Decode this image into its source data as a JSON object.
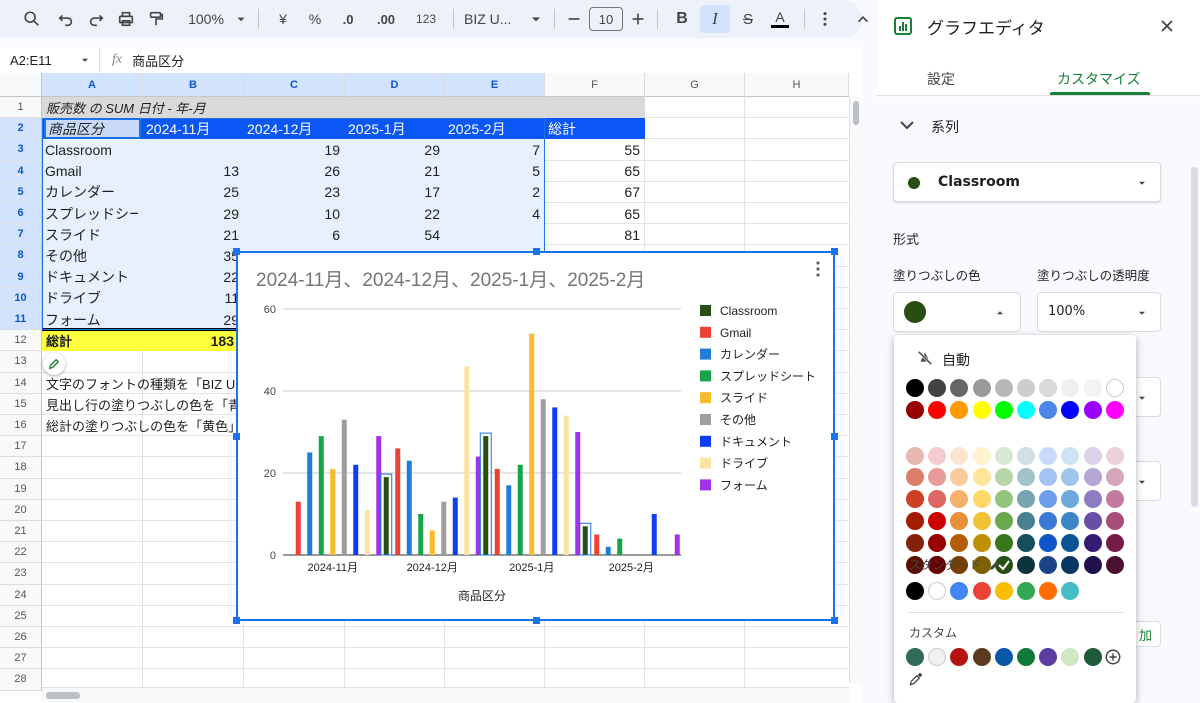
{
  "toolbar": {
    "zoom": "100%",
    "currency": "¥",
    "percent": "%",
    "dec_less": ".0",
    "dec_more": ".00",
    "number_format": "123",
    "font": "BIZ U...",
    "font_size": "10"
  },
  "formula_bar": {
    "name_box": "A2:E11",
    "fx": "fx",
    "content": "商品区分"
  },
  "sheet": {
    "columns": [
      "A",
      "B",
      "C",
      "D",
      "E",
      "F",
      "G",
      "H"
    ],
    "rows": [
      "1",
      "2",
      "3",
      "4",
      "5",
      "6",
      "7",
      "8",
      "9",
      "10",
      "11",
      "12",
      "13",
      "14",
      "15",
      "16",
      "17",
      "18",
      "19",
      "20",
      "21",
      "22",
      "23",
      "24",
      "25",
      "26",
      "27",
      "28"
    ],
    "pivot_title": "販売数 の SUM 日付 - 年-月",
    "header": [
      "商品区分",
      "2024-11月",
      "2024-12月",
      "2025-1月",
      "2025-2月",
      "総計"
    ],
    "data": [
      [
        "Classroom",
        "",
        "19",
        "29",
        "7",
        "55"
      ],
      [
        "Gmail",
        "13",
        "26",
        "21",
        "5",
        "65"
      ],
      [
        "カレンダー",
        "25",
        "23",
        "17",
        "2",
        "67"
      ],
      [
        "スプレッドシート",
        "29",
        "10",
        "22",
        "4",
        "65"
      ],
      [
        "スライド",
        "21",
        "6",
        "54",
        "",
        "81"
      ],
      [
        "その他",
        "35",
        "",
        "",
        "",
        ""
      ],
      [
        "ドキュメント",
        "22",
        "",
        "",
        "",
        ""
      ],
      [
        "ドライブ",
        "11",
        "",
        "",
        "",
        ""
      ],
      [
        "フォーム",
        "29",
        "",
        "",
        "",
        ""
      ]
    ],
    "total": [
      "総計",
      "183"
    ],
    "notes": [
      "文字のフォントの種類を「BIZ U",
      "見出し行の塗りつぶしの色を「青",
      "総計の塗りつぶしの色を「黄色」"
    ],
    "colors": {
      "header_fill": "#0b57f5",
      "total_fill": "#ffff3b",
      "title_fill": "#d9d9d9",
      "selection": "#e7f0fd"
    }
  },
  "chart_data": {
    "type": "bar",
    "title": "2024-11月、2024-12月、2025-1月、2025-2月",
    "xlabel": "商品区分",
    "ylabel": "",
    "ylim": [
      0,
      60
    ],
    "yticks": [
      "0",
      "20",
      "40",
      "60"
    ],
    "categories": [
      "2024-11月",
      "2024-12月",
      "2025-1月",
      "2025-2月"
    ],
    "series": [
      {
        "name": "Classroom",
        "color": "#274e13",
        "values": [
          0,
          19,
          29,
          7
        ]
      },
      {
        "name": "Gmail",
        "color": "#ea4335",
        "values": [
          13,
          26,
          21,
          5
        ]
      },
      {
        "name": "カレンダー",
        "color": "#1e7dd8",
        "values": [
          25,
          23,
          17,
          2
        ]
      },
      {
        "name": "スプレッドシート",
        "color": "#16a34a",
        "values": [
          29,
          10,
          22,
          4
        ]
      },
      {
        "name": "スライド",
        "color": "#fbbc2c",
        "values": [
          21,
          6,
          54,
          0
        ]
      },
      {
        "name": "その他",
        "color": "#9e9e9e",
        "values": [
          33,
          13,
          38,
          0
        ]
      },
      {
        "name": "ドキュメント",
        "color": "#0d3ef5",
        "values": [
          22,
          14,
          36,
          10
        ]
      },
      {
        "name": "ドライブ",
        "color": "#fbe3a4",
        "values": [
          11,
          46,
          34,
          0
        ]
      },
      {
        "name": "フォーム",
        "color": "#a032ea",
        "values": [
          29,
          24,
          30,
          5
        ]
      }
    ],
    "legend": "right",
    "grid": true
  },
  "panel": {
    "title": "グラフエディタ",
    "tabs": [
      "設定",
      "カスタマイズ"
    ],
    "section": "系列",
    "series_select": "Classroom",
    "format_label": "形式",
    "fill_color_label": "塗りつぶしの色",
    "fill_opacity_label": "塗りつぶしの透明度",
    "opacity_value": "100%",
    "fill_color": "#274e13",
    "add_label": "加",
    "palette": {
      "auto_label": "自動",
      "standard_label": "スタンダード",
      "custom_label": "カスタム",
      "grid": [
        [
          "#000000",
          "#434343",
          "#666666",
          "#999999",
          "#b7b7b7",
          "#cccccc",
          "#d9d9d9",
          "#efefef",
          "#f3f3f3",
          "#ffffff"
        ],
        [
          "#980000",
          "#ff0000",
          "#ff9900",
          "#ffff00",
          "#00ff00",
          "#00ffff",
          "#4a86e8",
          "#0000ff",
          "#9900ff",
          "#ff00ff"
        ],
        [
          "#e6b8af",
          "#f4cccc",
          "#fce5cd",
          "#fff2cc",
          "#d9ead3",
          "#d0e0e3",
          "#c9daf8",
          "#cfe2f3",
          "#d9d2e9",
          "#ead1dc"
        ],
        [
          "#dd7e6b",
          "#ea9999",
          "#f9cb9c",
          "#ffe599",
          "#b6d7a8",
          "#a2c4c9",
          "#a4c2f4",
          "#9fc5e8",
          "#b4a7d6",
          "#d5a6bd"
        ],
        [
          "#cc4125",
          "#e06666",
          "#f6b26b",
          "#ffd966",
          "#93c47d",
          "#76a5af",
          "#6d9eeb",
          "#6fa8dc",
          "#8e7cc3",
          "#c27ba0"
        ],
        [
          "#a61c00",
          "#cc0000",
          "#e69138",
          "#f1c232",
          "#6aa84f",
          "#45818e",
          "#3c78d8",
          "#3d85c6",
          "#674ea7",
          "#a64d79"
        ],
        [
          "#85200c",
          "#990000",
          "#b45f06",
          "#bf9000",
          "#38761d",
          "#134f5c",
          "#1155cc",
          "#0b5394",
          "#351c75",
          "#741b47"
        ],
        [
          "#5b0f00",
          "#660000",
          "#783f04",
          "#7f6000",
          "#274e13",
          "#0c343d",
          "#1c4587",
          "#073763",
          "#20124d",
          "#4c1130"
        ]
      ],
      "standard": [
        "#000000",
        "#ffffff",
        "#4285f4",
        "#ea4335",
        "#fbbc04",
        "#34a853",
        "#ff6d01",
        "#46bdc6"
      ],
      "custom": [
        "#2f6b55",
        "#f1f1f1",
        "#b31412",
        "#5a3b22",
        "#0b57a8",
        "#0f7a3a",
        "#5b3ca0",
        "#cfe8c3",
        "#1e5b3a"
      ]
    }
  }
}
